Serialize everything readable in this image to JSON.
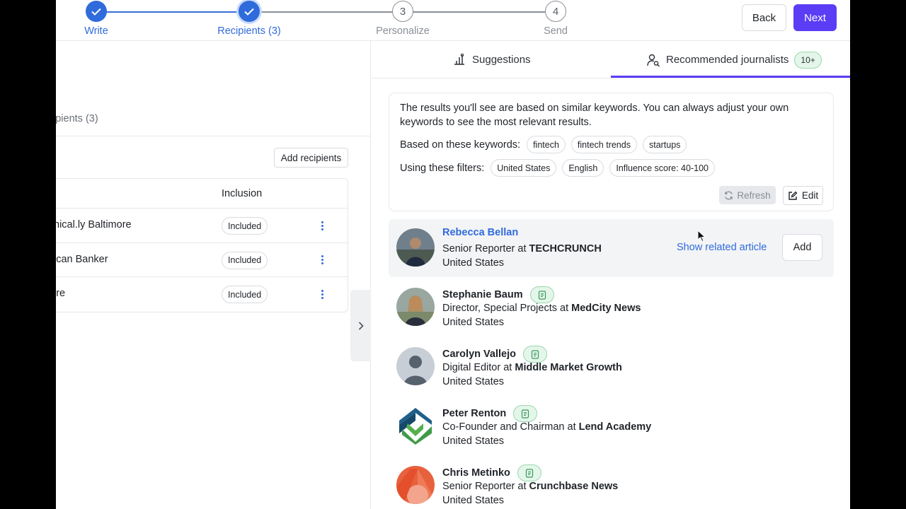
{
  "stepper": {
    "steps": [
      {
        "number": "",
        "label": "Write",
        "state": "done"
      },
      {
        "number": "",
        "label": "Recipients (3)",
        "state": "active"
      },
      {
        "number": "3",
        "label": "Personalize",
        "state": "todo"
      },
      {
        "number": "4",
        "label": "Send",
        "state": "todo"
      }
    ],
    "back_label": "Back",
    "next_label": "Next"
  },
  "left": {
    "recipients_tab": "ipients (3)",
    "add_recipients_label": "Add recipients",
    "inclusion_header": "Inclusion",
    "rows": [
      {
        "name": "nical.ly Baltimore",
        "status": "Included"
      },
      {
        "name": "ican Banker",
        "status": "Included"
      },
      {
        "name": "ire",
        "status": "Included"
      }
    ],
    "collapse_icon": "chevron-right-icon"
  },
  "tabs": {
    "suggestions": "Suggestions",
    "recommended": "Recommended journalists",
    "recommended_count": "10+"
  },
  "info": {
    "description": "The results you'll see are based on similar keywords. You can always adjust your own keywords to see the most relevant results.",
    "keywords_label": "Based on these keywords:",
    "keywords": [
      "fintech",
      "fintech trends",
      "startups"
    ],
    "filters_label": "Using these filters:",
    "filters": [
      "United States",
      "English",
      "Influence score: 40-100"
    ],
    "refresh_label": "Refresh",
    "edit_label": "Edit"
  },
  "journalists": [
    {
      "name": "Rebecca Bellan",
      "role": "Senior Reporter at ",
      "outlet": "TECHCRUNCH",
      "location": "United States",
      "show_related": "Show related article",
      "add_label": "Add"
    },
    {
      "name": "Stephanie Baum",
      "role": "Director, Special Projects at ",
      "outlet": "MedCity News",
      "location": "United States"
    },
    {
      "name": "Carolyn Vallejo",
      "role": "Digital Editor at ",
      "outlet": "Middle Market Growth",
      "location": "United States"
    },
    {
      "name": "Peter Renton",
      "role": "Co-Founder and Chairman at ",
      "outlet": "Lend Academy",
      "location": "United States"
    },
    {
      "name": "Chris Metinko",
      "role": "Senior Reporter at ",
      "outlet": "Crunchbase News",
      "location": "United States"
    }
  ],
  "colors": {
    "primary": "#5b3df5",
    "link": "#2f6bdb",
    "success_bg": "#e4f6ea"
  }
}
